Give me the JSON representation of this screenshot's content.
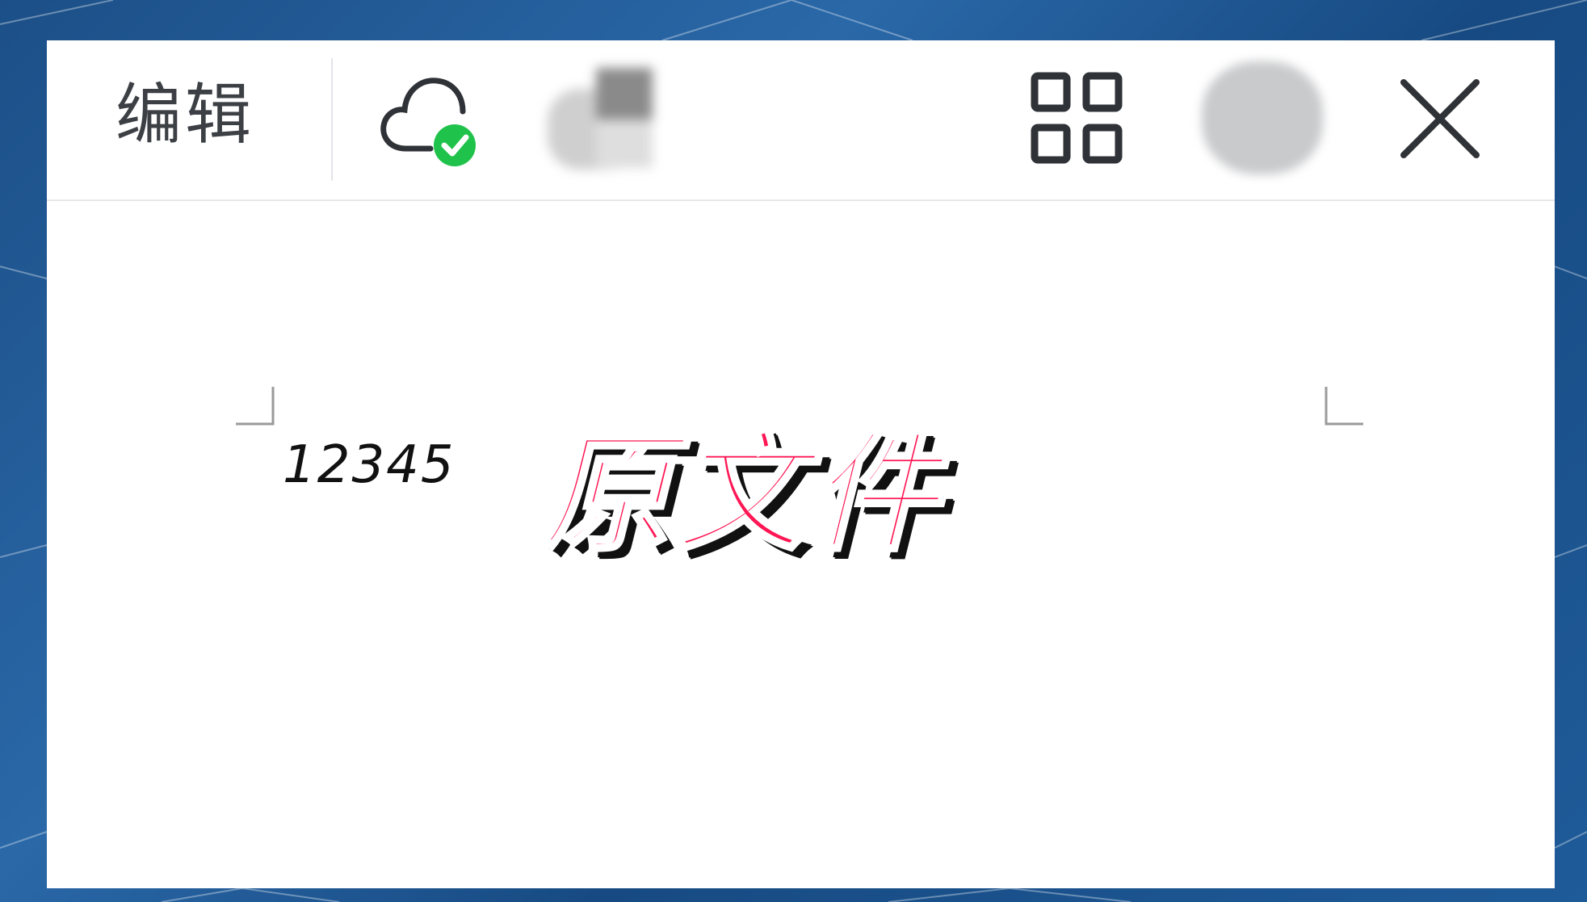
{
  "toolbar": {
    "edit_label": "编辑",
    "cloud_icon": "cloud-synced-icon",
    "grid_icon": "grid-apps-icon",
    "close_icon": "close-icon",
    "sync_color": "#1fc24a"
  },
  "document": {
    "text": "12345"
  },
  "overlay": {
    "caption": "原文件",
    "caption_color": "#ff1654"
  }
}
